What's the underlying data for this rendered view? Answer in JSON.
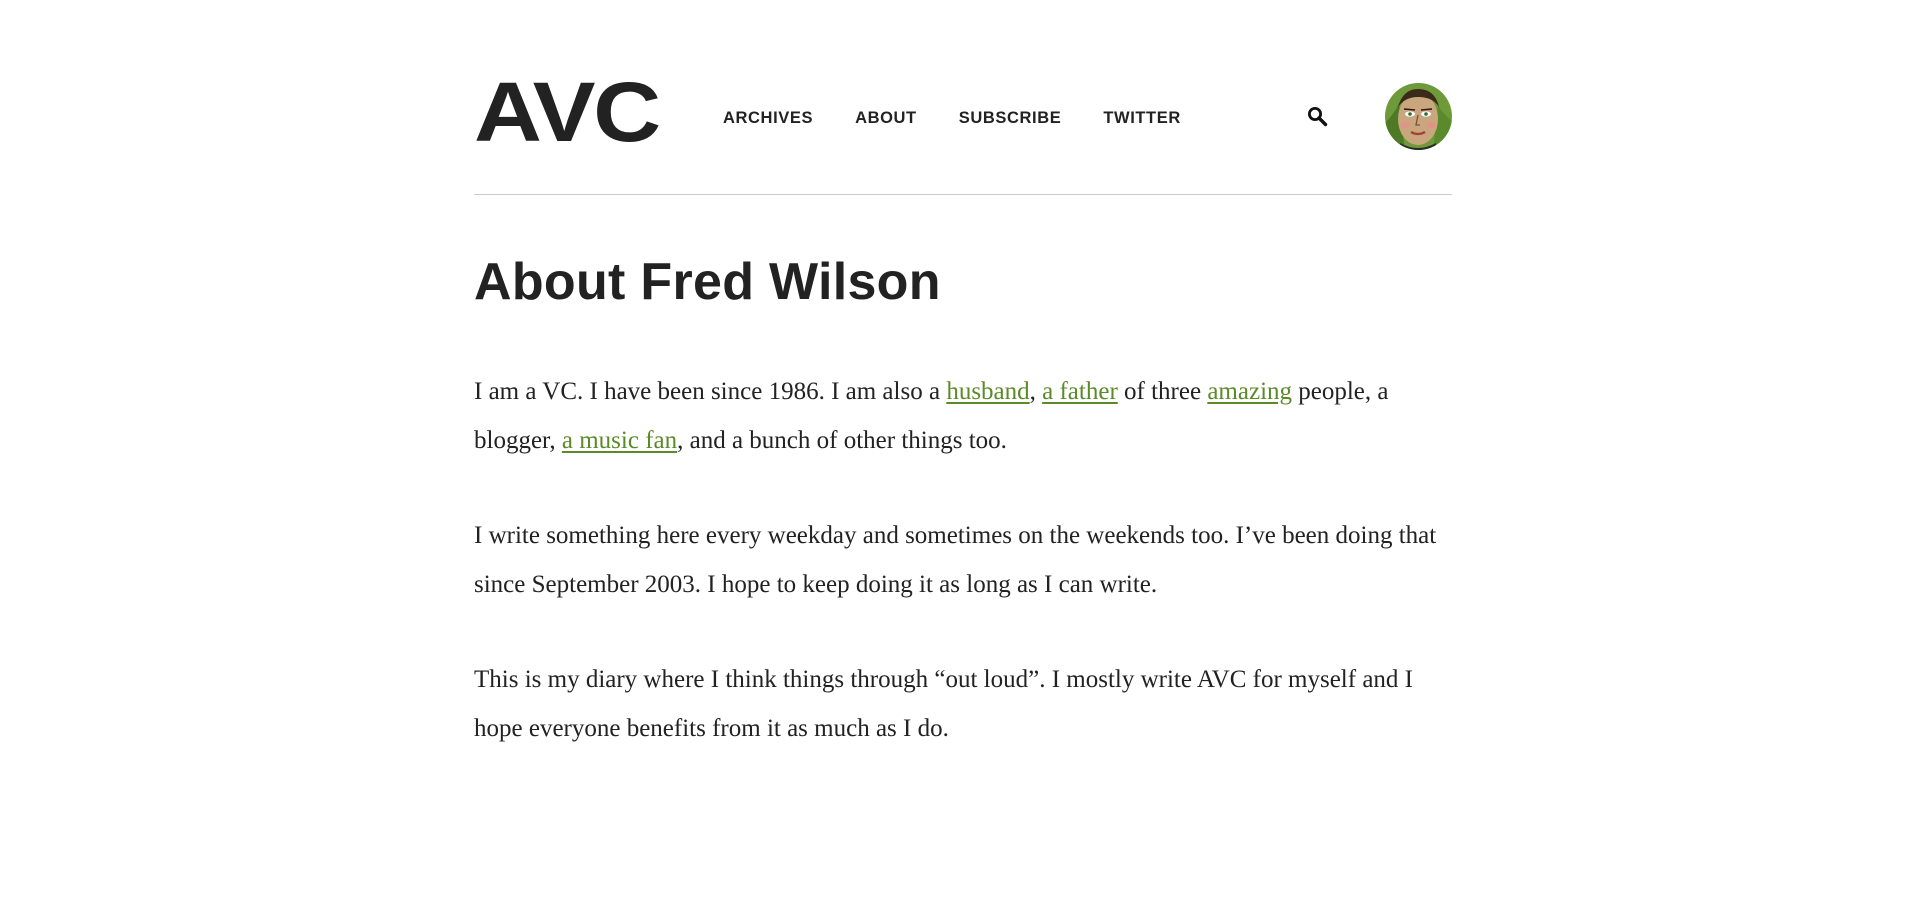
{
  "site": {
    "logo": "AVC"
  },
  "nav": {
    "items": [
      {
        "label": "ARCHIVES"
      },
      {
        "label": "ABOUT"
      },
      {
        "label": "SUBSCRIBE"
      },
      {
        "label": "TWITTER"
      }
    ]
  },
  "icons": {
    "search": "search-icon",
    "avatar": "avatar"
  },
  "colors": {
    "text": "#222222",
    "link": "#5b8a28",
    "divider": "#cccccc"
  },
  "page": {
    "title": "About Fred Wilson",
    "p1": {
      "t1": "I am a VC. I have been since 1986. I am also a ",
      "link_husband": "husband",
      "t2": ", ",
      "link_father": "a father",
      "t3": " of three ",
      "link_amazing": "amazing",
      "t4": " people, a blogger, ",
      "link_music": "a music fan",
      "t5": ", and a bunch of other things too."
    },
    "p2": "I write something here every weekday and sometimes on the weekends too. I’ve been doing that since September 2003. I hope to keep doing it as long as I can write.",
    "p3": "This is my diary where I think things through “out loud”. I mostly write AVC for myself and I hope everyone benefits from it as much as I do."
  }
}
